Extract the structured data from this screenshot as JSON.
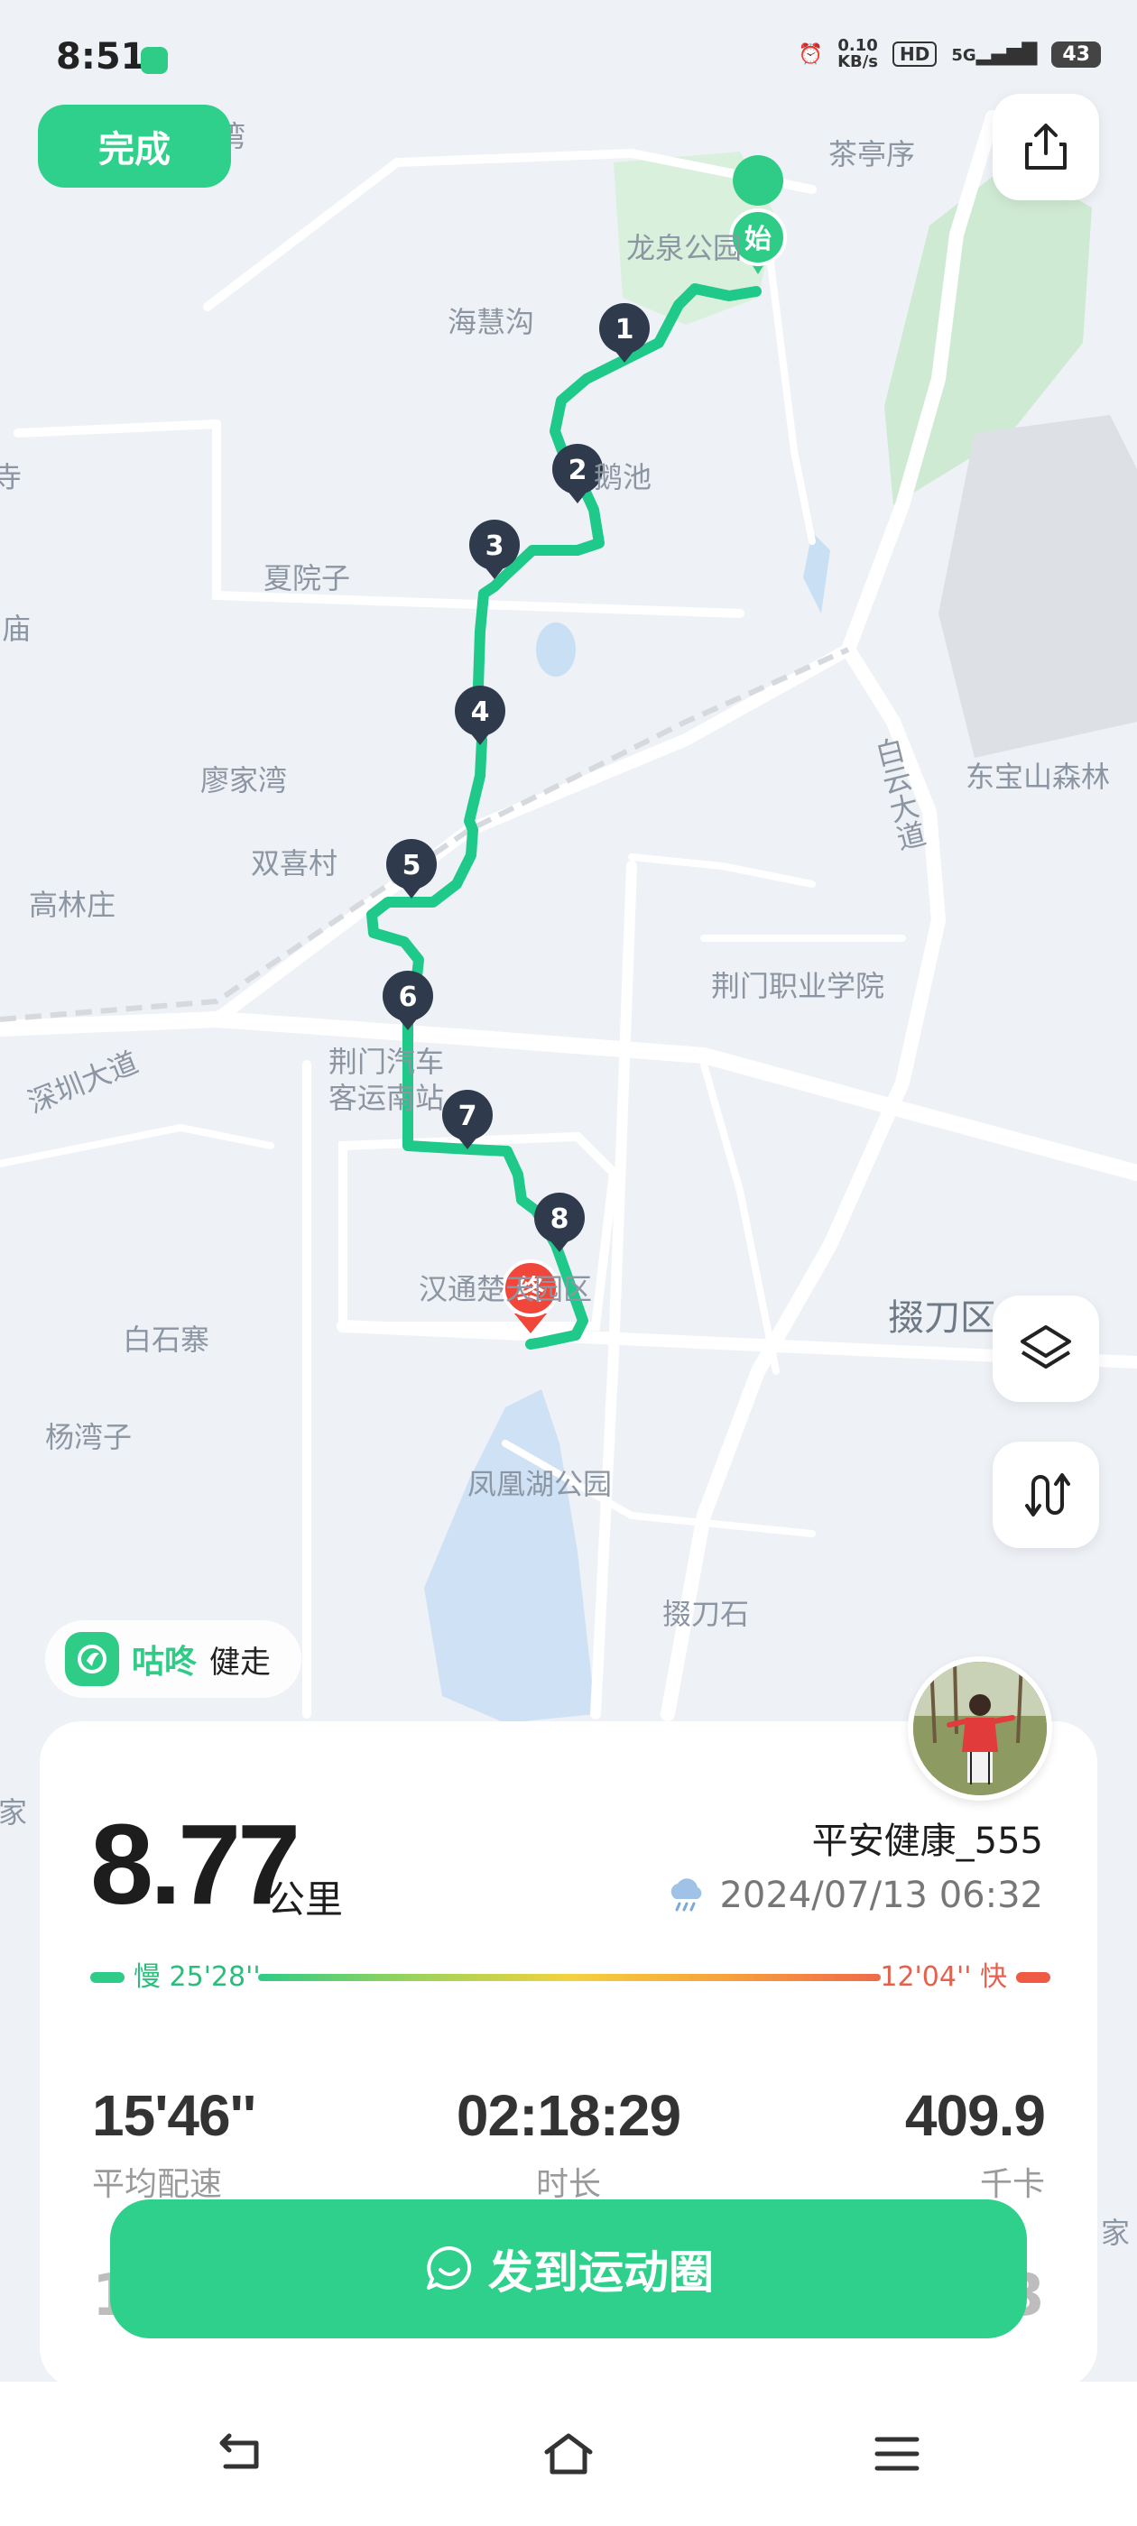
{
  "status_bar": {
    "time": "8:51",
    "net_speed": "0.10",
    "net_unit": "KB/s",
    "hd": "HD",
    "signal": "5G",
    "battery": "43"
  },
  "top": {
    "done_label": "完成"
  },
  "map": {
    "labels": [
      "茶亭序",
      "龙泉公园",
      "海慧沟",
      "鹅池",
      "夏院子",
      "白云大道",
      "东宝山森林",
      "廖家湾",
      "双喜村",
      "高林庄",
      "荆门职业学院",
      "深圳大道",
      "荆门汽车客运南站",
      "汉通楚天园区",
      "掇刀区",
      "白石寨",
      "杨湾子",
      "凤凰湖公园",
      "掇刀石",
      "寺",
      "庙",
      "湾",
      "家",
      "家"
    ],
    "start_marker": "始",
    "end_marker": "终",
    "km_markers": [
      "1",
      "2",
      "3",
      "4",
      "5",
      "6",
      "7",
      "8"
    ]
  },
  "brand": {
    "name": "咕咚",
    "sub": "健走"
  },
  "summary": {
    "distance": "8.77",
    "distance_unit": "公里",
    "username": "平安健康_555",
    "datetime": "2024/07/13 06:32",
    "pace_slow": "慢 25'28''",
    "pace_fast": "12'04'' 快",
    "stats": [
      {
        "value": "15'46''",
        "label": "平均配速"
      },
      {
        "value": "02:18:29",
        "label": "时长"
      },
      {
        "value": "409.9",
        "label": "千卡"
      }
    ],
    "row2_partial": [
      "1",
      "3"
    ]
  },
  "actions": {
    "share_label": "发到运动圈"
  },
  "colors": {
    "accent": "#2ED08B",
    "route": "#1FC98A",
    "marker": "#2F3B4C",
    "end": "#F0473A",
    "fast": "#E8604C"
  }
}
